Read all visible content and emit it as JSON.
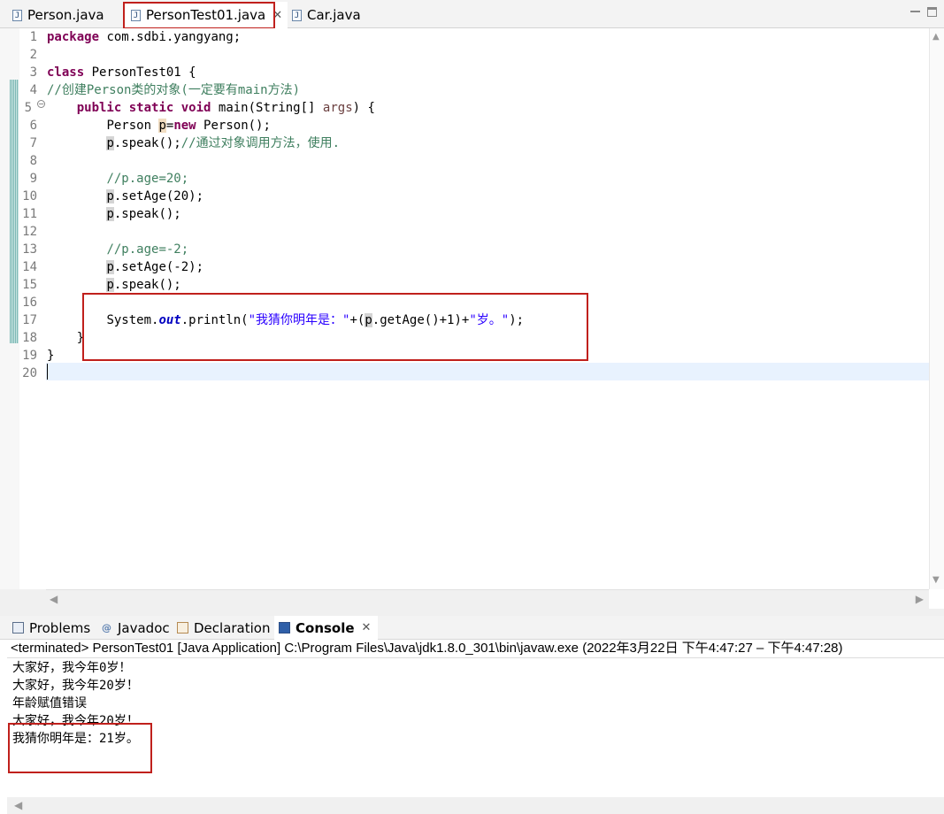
{
  "editor_tabs": [
    {
      "label": "Person.java",
      "icon": "java-file-icon"
    },
    {
      "label": "PersonTest01.java",
      "icon": "java-file-icon",
      "active": true,
      "close": "✕"
    },
    {
      "label": "Car.java",
      "icon": "java-file-icon"
    }
  ],
  "editor": {
    "line_numbers": [
      "1",
      "2",
      "3",
      "4",
      "5",
      "6",
      "7",
      "8",
      "9",
      "10",
      "11",
      "12",
      "13",
      "14",
      "15",
      "16",
      "17",
      "18",
      "19",
      "20"
    ],
    "code": {
      "l1_kw": "package",
      "l1_rest": " com.sdbi.yangyang;",
      "l3_kw": "class",
      "l3_rest": " PersonTest01 {",
      "l4_comment": "//创建Person类的对象(一定要有main方法)",
      "l5_pub": "public",
      "l5_static": "static",
      "l5_void": "void",
      "l5_mid": " main(String[] ",
      "l5_args": "args",
      "l5_end": ") {",
      "l6_a": "Person ",
      "l6_p": "p",
      "l6_eq": "=",
      "l6_new": "new",
      "l6_end": " Person();",
      "l7_p": "p",
      "l7_call": ".speak();",
      "l7_comment": "//通过对象调用方法，使用.",
      "l9_comment": "//p.age=20;",
      "l10_p": "p",
      "l10_call": ".setAge(20);",
      "l11_p": "p",
      "l11_call": ".speak();",
      "l13_comment": "//p.age=-2;",
      "l14_p": "p",
      "l14_call": ".setAge(-2);",
      "l15_p": "p",
      "l15_call": ".speak();",
      "l17_sys": "System.",
      "l17_out": "out",
      "l17_print": ".println(",
      "l17_str1": "\"我猜你明年是：\"",
      "l17_plus": "+(",
      "l17_p": "p",
      "l17_getage": ".getAge()+1)+",
      "l17_str2": "\"岁。\"",
      "l17_end": ");",
      "l18_close": "}",
      "l19_close": "}"
    }
  },
  "views": {
    "tabs": [
      {
        "label": "Problems",
        "icon": "problems-icon"
      },
      {
        "label": "Javadoc",
        "icon": "javadoc-icon",
        "glyph": "@"
      },
      {
        "label": "Declaration",
        "icon": "declaration-icon"
      },
      {
        "label": "Console",
        "icon": "console-icon",
        "active": true,
        "close": "✕"
      }
    ]
  },
  "console": {
    "status": "<terminated> PersonTest01 [Java Application] C:\\Program Files\\Java\\jdk1.8.0_301\\bin\\javaw.exe  (2022年3月22日 下午4:47:27 – 下午4:47:28)",
    "output": [
      "大家好，我今年0岁！",
      "大家好，我今年20岁！",
      "年龄赋值错误",
      "大家好，我今年20岁！",
      "我猜你明年是：21岁。"
    ]
  },
  "colors": {
    "highlight_box": "#c0201c",
    "keyword": "#7f0055",
    "comment": "#3f7f5f",
    "string": "#2a00ff",
    "static_field": "#0000c0",
    "current_line": "#e8f2fe"
  }
}
